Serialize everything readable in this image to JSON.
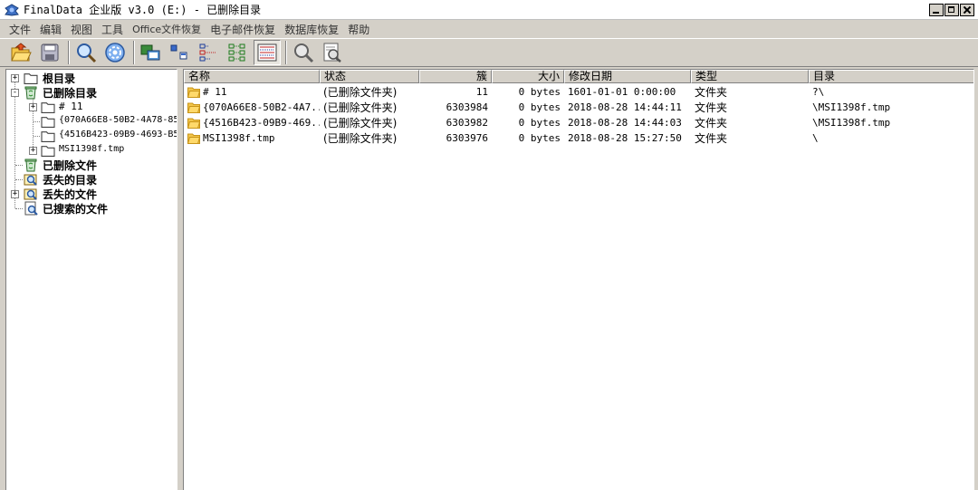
{
  "window": {
    "title": "FinalData 企业版 v3.0 (E:) - 已删除目录",
    "controls": {
      "minimize": "minimize",
      "maximize": "maximize",
      "close": "close"
    }
  },
  "menu": [
    {
      "label": "文件"
    },
    {
      "label": "编辑"
    },
    {
      "label": "视图"
    },
    {
      "label": "工具"
    },
    {
      "label": "Office文件恢复"
    },
    {
      "label": "电子邮件恢复"
    },
    {
      "label": "数据库恢复"
    },
    {
      "label": "帮助"
    }
  ],
  "toolbar": {
    "buttons": [
      {
        "icon": "open-folder-icon"
      },
      {
        "icon": "save-icon"
      },
      {
        "icon": "search-icon"
      },
      {
        "icon": "settings-disc-icon"
      },
      {
        "icon": "large-icons-view-icon"
      },
      {
        "icon": "small-icons-view-icon"
      },
      {
        "icon": "list-view-icon"
      },
      {
        "icon": "tree-view-icon"
      },
      {
        "icon": "details-view-icon",
        "pressed": true
      },
      {
        "icon": "find-icon"
      },
      {
        "icon": "find-document-icon"
      }
    ]
  },
  "tree": {
    "items": [
      {
        "label": "根目录",
        "bold": true,
        "expander": "+"
      },
      {
        "label": "已删除目录",
        "bold": true,
        "expander": "-"
      },
      {
        "label": "# 11",
        "expander": "+"
      },
      {
        "label": "{070A66E8-50B2-4A78-85"
      },
      {
        "label": "{4516B423-09B9-4693-B5"
      },
      {
        "label": "MSI1398f.tmp",
        "expander": "+"
      },
      {
        "label": "已删除文件",
        "bold": true
      },
      {
        "label": "丢失的目录",
        "bold": true
      },
      {
        "label": "丢失的文件",
        "bold": true,
        "expander": "+"
      },
      {
        "label": "已搜索的文件",
        "bold": true
      }
    ]
  },
  "list": {
    "columns": [
      "名称",
      "状态",
      "簇",
      "大小",
      "修改日期",
      "类型",
      "目录"
    ],
    "rows": [
      {
        "name": "# 11",
        "status": "(已删除文件夹)",
        "cluster": "11",
        "size": "0 bytes",
        "modified": "1601-01-01 0:00:00",
        "type": "文件夹",
        "dir": "?\\"
      },
      {
        "name": "{070A66E8-50B2-4A7...",
        "status": "(已删除文件夹)",
        "cluster": "6303984",
        "size": "0 bytes",
        "modified": "2018-08-28 14:44:11",
        "type": "文件夹",
        "dir": "\\MSI1398f.tmp"
      },
      {
        "name": "{4516B423-09B9-469...",
        "status": "(已删除文件夹)",
        "cluster": "6303982",
        "size": "0 bytes",
        "modified": "2018-08-28 14:44:03",
        "type": "文件夹",
        "dir": "\\MSI1398f.tmp"
      },
      {
        "name": "MSI1398f.tmp",
        "status": "(已删除文件夹)",
        "cluster": "6303976",
        "size": "0 bytes",
        "modified": "2018-08-28 15:27:50",
        "type": "文件夹",
        "dir": "\\"
      }
    ]
  },
  "colors": {
    "folder": "#f2c54a",
    "folder_dark": "#c89418",
    "chrome": "#d4d0c8"
  }
}
